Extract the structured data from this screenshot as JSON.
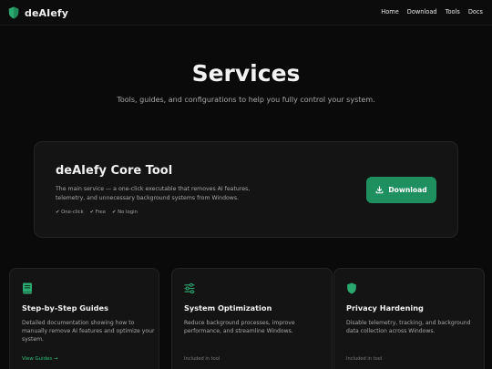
{
  "nav": {
    "brand": "deAIefy",
    "links": [
      "Home",
      "Download",
      "Tools",
      "Docs"
    ]
  },
  "hero": {
    "title": "Services",
    "subtitle": "Tools, guides, and configurations to help you fully control your system."
  },
  "core": {
    "title": "deAIefy Core Tool",
    "description": "The main service — a one-click executable that removes AI features, telemetry, and unnecessary background systems from Windows.",
    "tags": [
      "✔ One-click",
      "✔ Free",
      "✔ No login"
    ],
    "download_label": "Download"
  },
  "cards": [
    {
      "icon": "book-icon",
      "title": "Step-by-Step Guides",
      "description": "Detailed documentation showing how to manually remove AI features and optimize your system.",
      "link": "View Guides →"
    },
    {
      "icon": "sliders-icon",
      "title": "System Optimization",
      "description": "Reduce background processes, improve performance, and streamline Windows.",
      "footer": "Included in tool"
    },
    {
      "icon": "shield-icon",
      "title": "Privacy Hardening",
      "description": "Disable telemetry, tracking, and background data collection across Windows.",
      "footer": "Included in tool"
    }
  ],
  "colors": {
    "background": "#0a0a0a",
    "card": "#141414",
    "accent": "#1e8f5e",
    "link": "#2fbf78"
  }
}
